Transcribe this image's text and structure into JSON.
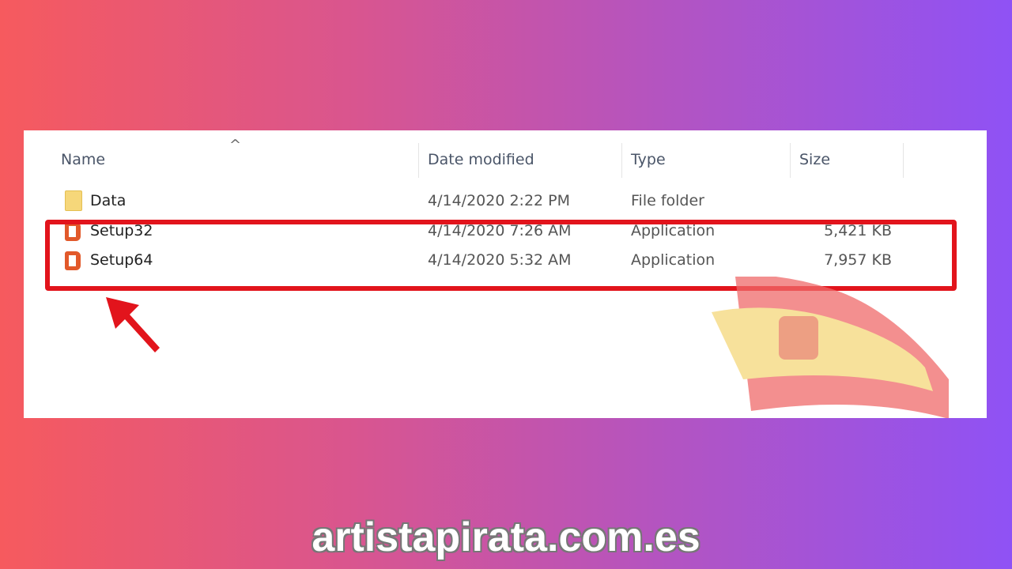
{
  "columns": {
    "name": "Name",
    "date": "Date modified",
    "type": "Type",
    "size": "Size"
  },
  "sort_icon": "chevron-up-icon",
  "files": [
    {
      "name": "Data",
      "date": "4/14/2020 2:22 PM",
      "type": "File folder",
      "size": "",
      "icon": "folder-icon"
    },
    {
      "name": "Setup32",
      "date": "4/14/2020 7:26 AM",
      "type": "Application",
      "size": "5,421 KB",
      "icon": "office-icon"
    },
    {
      "name": "Setup64",
      "date": "4/14/2020 5:32 AM",
      "type": "Application",
      "size": "7,957 KB",
      "icon": "office-icon"
    }
  ],
  "highlight_color": "#e2141c",
  "watermark": "artistapirata.com.es"
}
